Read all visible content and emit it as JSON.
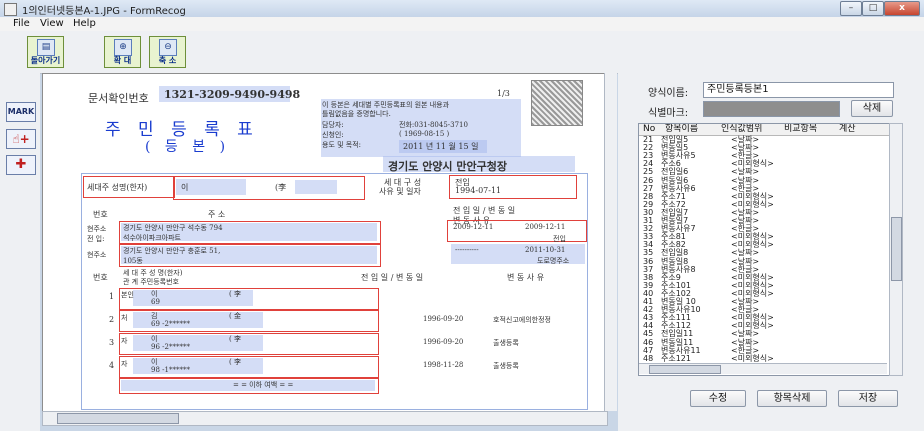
{
  "window": {
    "title": "1의인터넷등본A-1.JPG - FormRecog",
    "min": "–",
    "max": "□",
    "close": "x"
  },
  "menu": [
    "File",
    "View",
    "Help"
  ],
  "toolbar": {
    "back": "돌아가기",
    "zoom_in": "확 대",
    "zoom_out": "축 소"
  },
  "leftbar": {
    "mark": "MARK"
  },
  "document": {
    "doc_number_label": "문서확인번호",
    "doc_number": "1321-3209-9490-9498",
    "page": "1/3",
    "title": "주 민 등 록 표",
    "subtitle": "( 등 본 )",
    "notice_1": "이 등본은 세대별 주민등록표의 원본 내용과",
    "notice_2": "틀림없음을 증명합니다.",
    "contact_label": "담당자:",
    "contact_phone": "전화:031-8045-3710",
    "issuer_label": "신청인:",
    "issuer_date": "( 1969-08-15 )",
    "purpose_label": "용도 및 목적:",
    "issue_date": "2011 년 11 월 15 일",
    "office": "경기도 안양시 만안구청장",
    "head_label": "세대주 성명(한자)",
    "head_name": "이",
    "head_hanja": "(李",
    "composition_label": "세 대 구 성",
    "composition_sub": "사유 및 일자",
    "composition_value": "전입",
    "composition_date": "1994-07-11",
    "col_no": "번호",
    "col_address": "주               소",
    "col_move_in": "전 입 일  /  변 동 일",
    "col_change_reason": "변   동   사   유",
    "addr_prev_label_1": "현주소",
    "addr_prev_label_2": "전 입:",
    "addr_prev_1": "경기도 안양시 만안구 석수동 794",
    "addr_prev_2": "석수아이파크아파트",
    "addr_prev_date": "2009-12-11",
    "addr_prev_change": "2009-12-11",
    "addr_prev_reason": "전입",
    "addr_cur_label": "현주소",
    "addr_cur_1": "경기도 안양시 만안구 충훈로 51,",
    "addr_cur_2": "105동",
    "addr_cur_dash": "----------",
    "addr_cur_date": "2011-10-31",
    "addr_cur_reason": "도로명주소",
    "member_header_no": "번호",
    "member_header_rel": "세 대 주  성 명(한자)",
    "member_header_rel2": "관  계   주민등록번호",
    "member_header_date": "전 입 일 / 변 동 일",
    "member_header_reason": "변 동 사 유",
    "members": [
      {
        "no": "1",
        "rel": "본인",
        "name": "이",
        "hanja": "( 李",
        "rrn": "69",
        "date": "",
        "reason": ""
      },
      {
        "no": "2",
        "rel": "처",
        "name": "김",
        "hanja": "( 金",
        "rrn": "69      -2******",
        "date": "1996-09-20",
        "reason": "호적신고에의한정정"
      },
      {
        "no": "3",
        "rel": "자",
        "name": "이",
        "hanja": "( 李",
        "rrn": "96      -2******",
        "date": "1996-09-20",
        "reason": "출생등록"
      },
      {
        "no": "4",
        "rel": "자",
        "name": "이",
        "hanja": "( 李",
        "rrn": "98      -1******",
        "date": "1998-11-28",
        "reason": "출생등록"
      }
    ],
    "end_text": "= = 이하 여백 = ="
  },
  "panel": {
    "form_name_label": "양식이름:",
    "form_name_value": "주민등록등본1",
    "id_mark_label": "식별마크:",
    "delete_button": "삭제",
    "columns": [
      "No",
      "항목이름",
      "인식값범위",
      "비교항목",
      "계산"
    ],
    "rows": [
      {
        "no": "21",
        "name": "전입일5",
        "range": "<날짜>"
      },
      {
        "no": "22",
        "name": "변동일5",
        "range": "<날짜>"
      },
      {
        "no": "23",
        "name": "변동사유5",
        "range": "<한글>"
      },
      {
        "no": "24",
        "name": "주소6",
        "range": "<미외형식>"
      },
      {
        "no": "25",
        "name": "전입일6",
        "range": "<날짜>"
      },
      {
        "no": "26",
        "name": "변동일6",
        "range": "<날짜>"
      },
      {
        "no": "27",
        "name": "변동사유6",
        "range": "<한글>"
      },
      {
        "no": "28",
        "name": "주소71",
        "range": "<미외형식>"
      },
      {
        "no": "29",
        "name": "주소72",
        "range": "<미외형식>"
      },
      {
        "no": "30",
        "name": "전입일7",
        "range": "<날짜>"
      },
      {
        "no": "31",
        "name": "변동일7",
        "range": "<날짜>"
      },
      {
        "no": "32",
        "name": "변동사유7",
        "range": "<한글>"
      },
      {
        "no": "33",
        "name": "주소81",
        "range": "<미외형식>"
      },
      {
        "no": "34",
        "name": "주소82",
        "range": "<미외형식>"
      },
      {
        "no": "35",
        "name": "전입일8",
        "range": "<날짜>"
      },
      {
        "no": "36",
        "name": "변동일8",
        "range": "<날짜>"
      },
      {
        "no": "37",
        "name": "변동사유8",
        "range": "<한글>"
      },
      {
        "no": "38",
        "name": "주소9",
        "range": "<미외형식>"
      },
      {
        "no": "39",
        "name": "주소101",
        "range": "<미외형식>"
      },
      {
        "no": "40",
        "name": "주소102",
        "range": "<미외형식>"
      },
      {
        "no": "41",
        "name": "변동일 10",
        "range": "<날짜>"
      },
      {
        "no": "42",
        "name": "변동사유10",
        "range": "<한글>"
      },
      {
        "no": "43",
        "name": "주소111",
        "range": "<미외형식>"
      },
      {
        "no": "44",
        "name": "주소112",
        "range": "<미외형식>"
      },
      {
        "no": "45",
        "name": "전입일11",
        "range": "<날짜>"
      },
      {
        "no": "46",
        "name": "변동일11",
        "range": "<날짜>"
      },
      {
        "no": "47",
        "name": "변동사유11",
        "range": "<한글>"
      },
      {
        "no": "48",
        "name": "주소121",
        "range": "<미외형식>"
      }
    ],
    "edit_button": "수정",
    "delete_item_button": "항목삭제",
    "save_button": "저장"
  }
}
